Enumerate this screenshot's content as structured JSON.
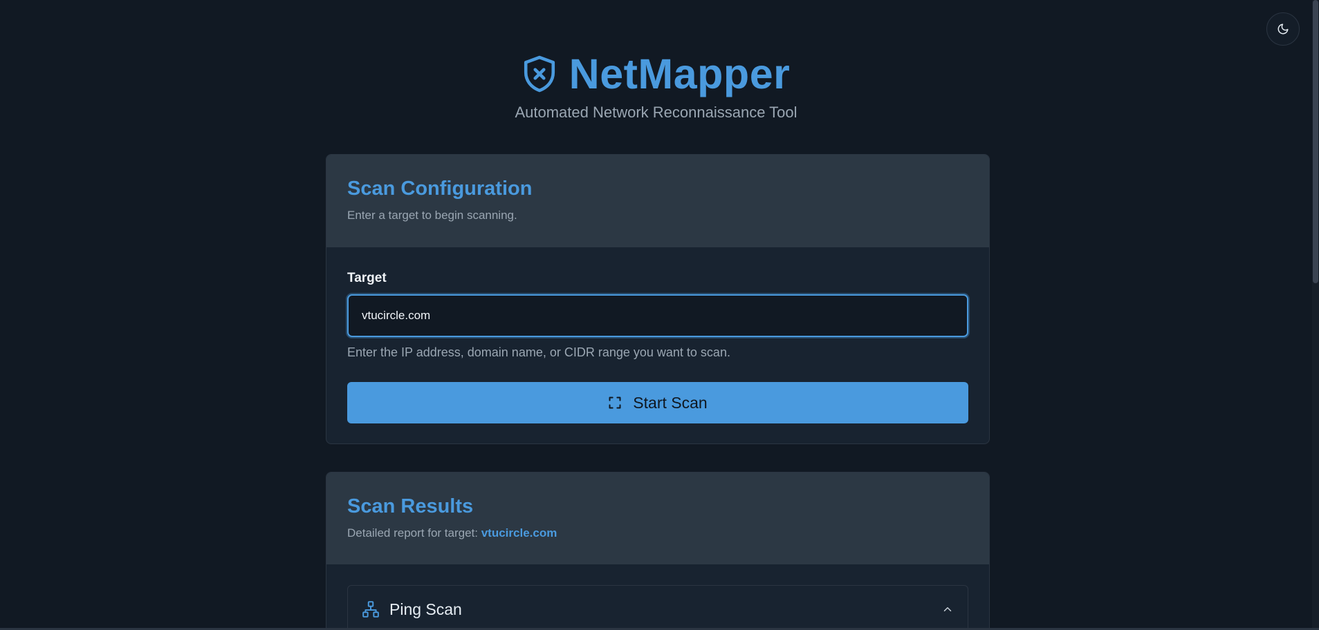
{
  "header": {
    "app_title": "NetMapper",
    "subtitle": "Automated Network Reconnaissance Tool",
    "logo_icon": "shield-x-icon"
  },
  "theme_toggle": {
    "icon": "moon-icon"
  },
  "config_card": {
    "title": "Scan Configuration",
    "description": "Enter a target to begin scanning.",
    "target_label": "Target",
    "target_value": "vtucircle.com",
    "help_text": "Enter the IP address, domain name, or CIDR range you want to scan.",
    "start_button_label": "Start Scan",
    "start_button_icon": "scan-frame-icon"
  },
  "results_card": {
    "title": "Scan Results",
    "description_prefix": "Detailed report for target:",
    "target": "vtucircle.com",
    "sections": [
      {
        "title": "Ping Scan",
        "icon": "network-icon",
        "state": "expanded"
      }
    ]
  },
  "colors": {
    "background": "#111923",
    "accent": "#4a9ade",
    "card_header": "#2c3844",
    "card_body": "#182330",
    "muted_text": "#9aa6b2"
  }
}
